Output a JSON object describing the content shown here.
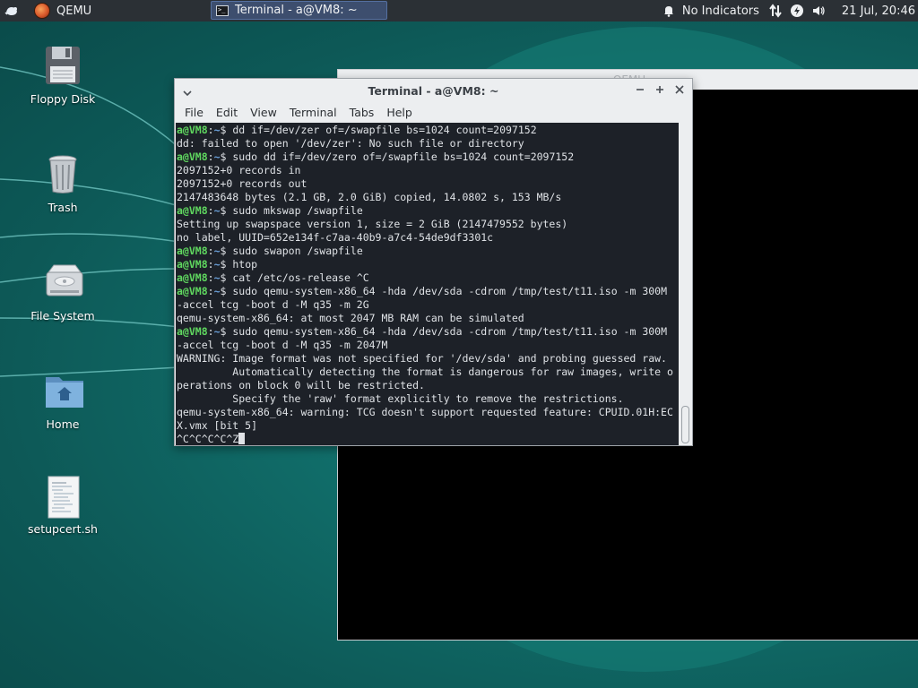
{
  "panel": {
    "launcher_label": "QEMU",
    "task_label": "Terminal - a@VM8: ~",
    "indicators_label": "No Indicators",
    "clock": "21 Jul, 20:46"
  },
  "desktop": {
    "icons": [
      {
        "label": "Floppy Disk",
        "icon": "floppy-disk-icon"
      },
      {
        "label": "Trash",
        "icon": "trash-icon"
      },
      {
        "label": "File System",
        "icon": "hard-drive-icon"
      },
      {
        "label": "Home",
        "icon": "home-folder-icon"
      },
      {
        "label": "setupcert.sh",
        "icon": "script-file-icon"
      }
    ]
  },
  "qemu_window": {
    "title": "QEMU"
  },
  "terminal": {
    "title": "Terminal - a@VM8: ~",
    "menu": [
      "File",
      "Edit",
      "View",
      "Terminal",
      "Tabs",
      "Help"
    ],
    "prompt_user": "a@VM8",
    "prompt_path": "~",
    "lines": [
      {
        "prompt": true,
        "text": "dd if=/dev/zer of=/swapfile bs=1024 count=2097152"
      },
      {
        "prompt": false,
        "text": "dd: failed to open '/dev/zer': No such file or directory"
      },
      {
        "prompt": true,
        "text": "sudo dd if=/dev/zero of=/swapfile bs=1024 count=2097152"
      },
      {
        "prompt": false,
        "text": "2097152+0 records in"
      },
      {
        "prompt": false,
        "text": "2097152+0 records out"
      },
      {
        "prompt": false,
        "text": "2147483648 bytes (2.1 GB, 2.0 GiB) copied, 14.0802 s, 153 MB/s"
      },
      {
        "prompt": true,
        "text": "sudo mkswap /swapfile"
      },
      {
        "prompt": false,
        "text": "Setting up swapspace version 1, size = 2 GiB (2147479552 bytes)"
      },
      {
        "prompt": false,
        "text": "no label, UUID=652e134f-c7aa-40b9-a7c4-54de9df3301c"
      },
      {
        "prompt": true,
        "text": "sudo swapon /swapfile"
      },
      {
        "prompt": true,
        "text": "htop"
      },
      {
        "prompt": true,
        "text": "cat /etc/os-release ^C"
      },
      {
        "prompt": true,
        "text": "sudo qemu-system-x86_64 -hda /dev/sda -cdrom /tmp/test/t11.iso -m 300M"
      },
      {
        "prompt": false,
        "text": "-accel tcg -boot d -M q35 -m 2G"
      },
      {
        "prompt": false,
        "text": "qemu-system-x86_64: at most 2047 MB RAM can be simulated"
      },
      {
        "prompt": true,
        "text": "sudo qemu-system-x86_64 -hda /dev/sda -cdrom /tmp/test/t11.iso -m 300M"
      },
      {
        "prompt": false,
        "text": "-accel tcg -boot d -M q35 -m 2047M"
      },
      {
        "prompt": false,
        "text": "WARNING: Image format was not specified for '/dev/sda' and probing guessed raw."
      },
      {
        "prompt": false,
        "text": "         Automatically detecting the format is dangerous for raw images, write o"
      },
      {
        "prompt": false,
        "text": "perations on block 0 will be restricted."
      },
      {
        "prompt": false,
        "text": "         Specify the 'raw' format explicitly to remove the restrictions."
      },
      {
        "prompt": false,
        "text": "qemu-system-x86_64: warning: TCG doesn't support requested feature: CPUID.01H:EC"
      },
      {
        "prompt": false,
        "text": "X.vmx [bit 5]"
      },
      {
        "prompt": false,
        "text": "^C^C^C^C^Z",
        "cursor": true
      }
    ]
  }
}
